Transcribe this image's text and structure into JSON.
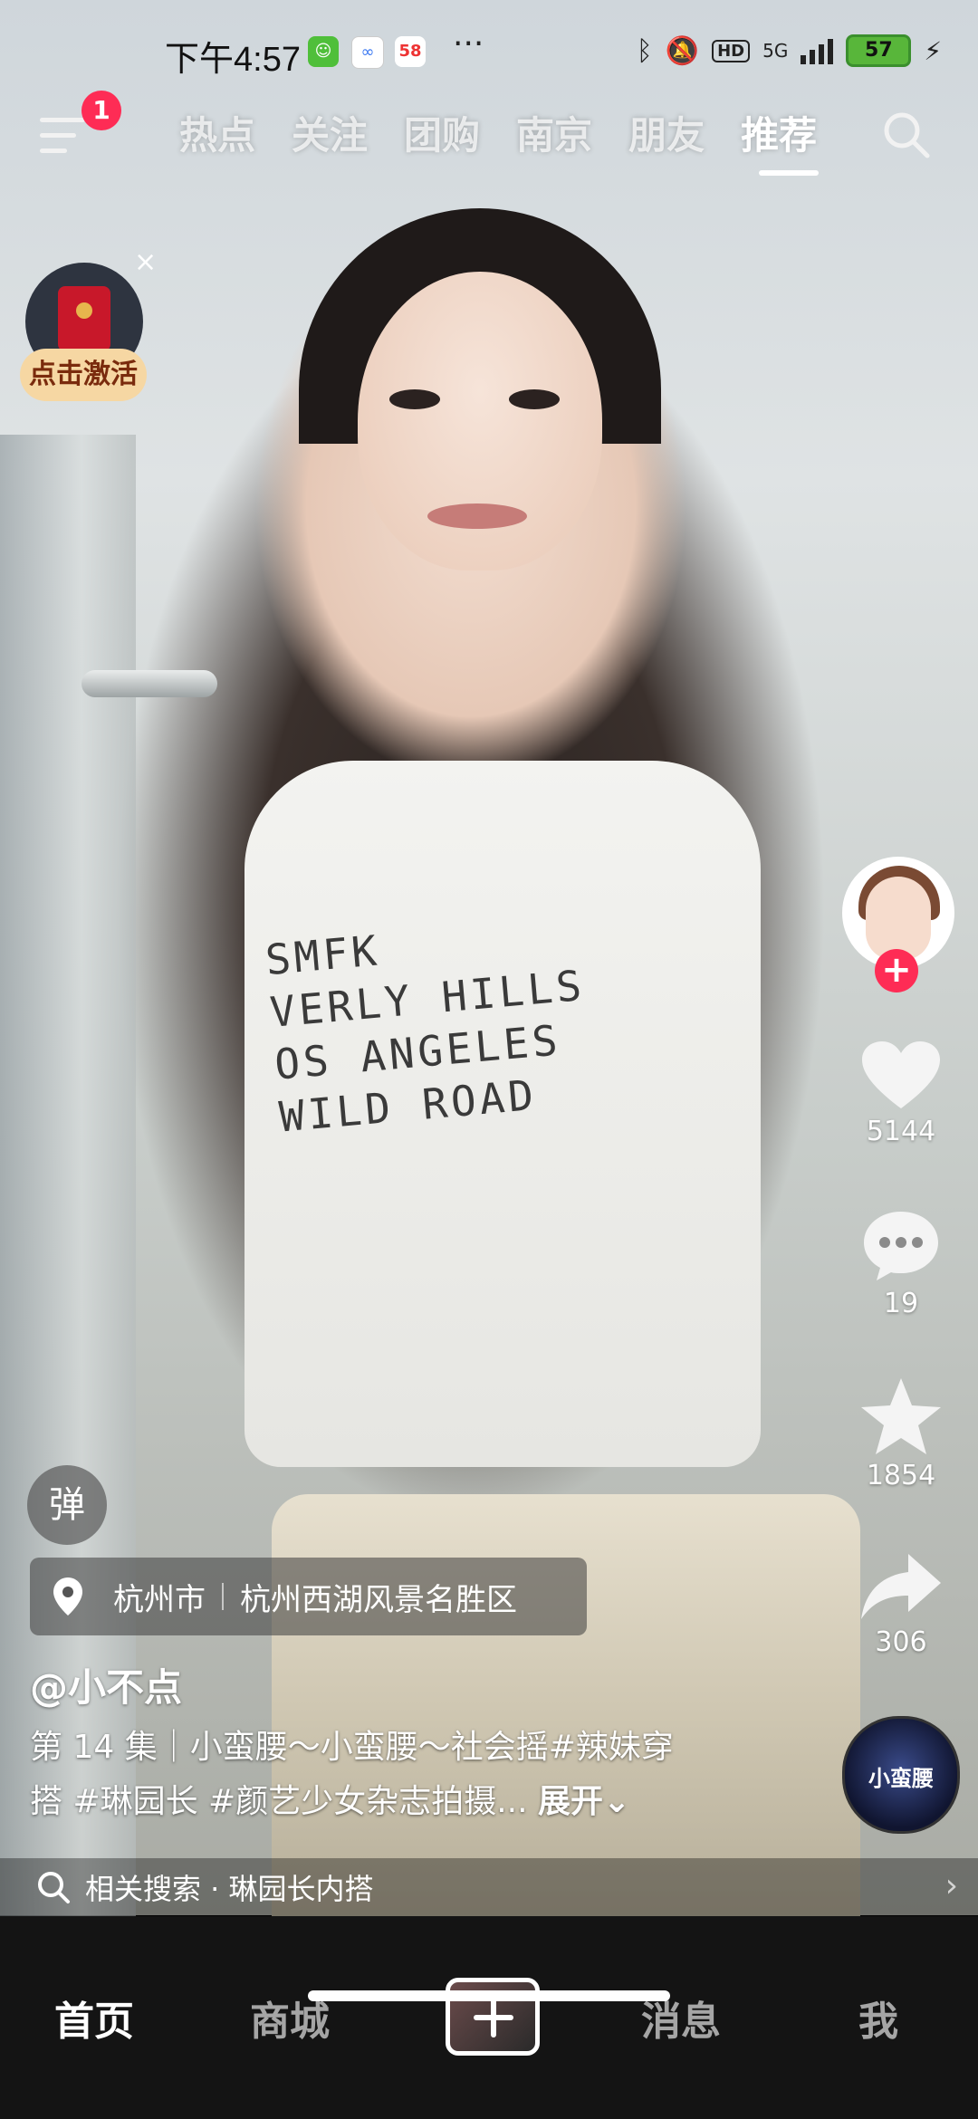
{
  "status_bar": {
    "time": "下午4:57",
    "app_badge_58": "58",
    "more_dots": "···",
    "network": "5G",
    "hd_label": "HD",
    "battery": "57"
  },
  "top_nav": {
    "menu_badge": "1",
    "tabs": [
      "热点",
      "关注",
      "团购",
      "南京",
      "朋友",
      "推荐"
    ],
    "active_tab": "推荐"
  },
  "red_packet": {
    "close": "×",
    "label": "点击激活"
  },
  "right_rail": {
    "follow": "+",
    "like_count": "5144",
    "comment_count": "19",
    "favorite_count": "1854",
    "share_count": "306",
    "music_label": "小蛮腰"
  },
  "video_info": {
    "danmu": "弹",
    "location_city": "杭州市",
    "location_place": "杭州西湖风景名胜区",
    "author": "@小不点",
    "caption_line1": "第 14 集｜小蛮腰～小蛮腰～社会摇#辣妹穿",
    "caption_line2": "搭 #琳园长 #颜艺少女杂志拍摄...",
    "expand": "展开⌄"
  },
  "related": {
    "text": "相关搜索 · 琳园长内搭",
    "chevron": "›"
  },
  "bottom_tabs": {
    "home": "首页",
    "mall": "商城",
    "messages": "消息",
    "me": "我"
  },
  "colors": {
    "accent_red": "#fe2c55",
    "tabbar_bg": "#141414"
  }
}
